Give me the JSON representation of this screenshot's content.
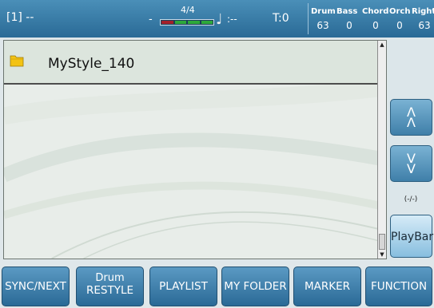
{
  "topbar": {
    "slot": "[1] --",
    "meter_dash": "-",
    "time_signature": "4/4",
    "tempo_dash": ":--",
    "transpose": "T:0",
    "volumes": [
      {
        "label": "Drum",
        "value": "63"
      },
      {
        "label": "Bass",
        "value": "0"
      },
      {
        "label": "Chord",
        "value": "0"
      },
      {
        "label": "Orch",
        "value": "0"
      },
      {
        "label": "Right",
        "value": "63"
      }
    ]
  },
  "browser": {
    "items": [
      {
        "name": "MyStyle_140",
        "icon": "folder-icon",
        "selected": true
      }
    ]
  },
  "side": {
    "up_label": "^",
    "down_label": "v",
    "pager": "(-/-)",
    "playbar_label": "PlayBar"
  },
  "bottom": {
    "sync_next": "SYNC/NEXT",
    "drum_restyle_line1": "Drum",
    "drum_restyle_line2": "RESTYLE",
    "playlist": "PLAYLIST",
    "my_folder": "MY FOLDER",
    "marker": "MARKER",
    "function": "FUNCTION"
  },
  "colors": {
    "header": "#2a6a96",
    "button": "#3f7fa9",
    "list_bg": "#e8ede9",
    "folder": "#f3c314",
    "beat_accent": "#a5202a",
    "beat_normal": "#2da93a"
  }
}
